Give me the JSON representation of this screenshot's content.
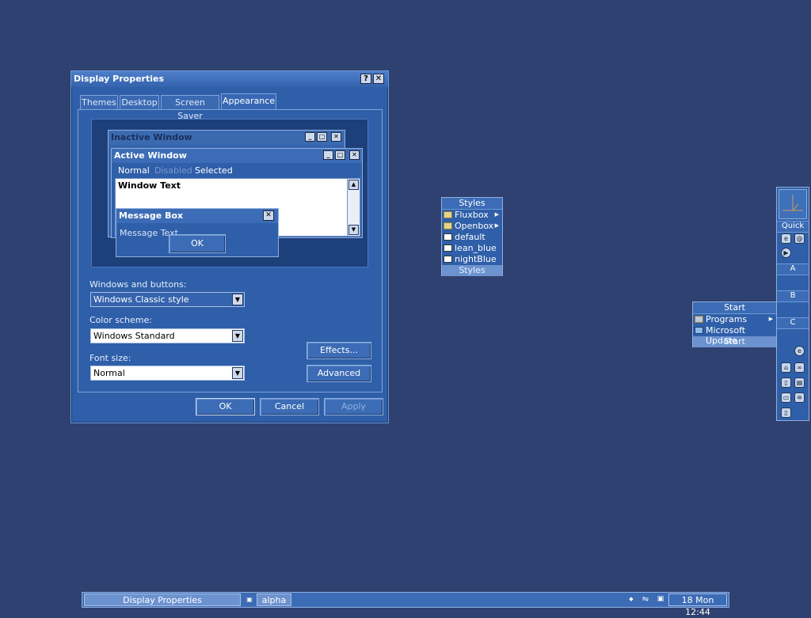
{
  "dialog": {
    "title": "Display Properties",
    "help_glyph": "?",
    "close_glyph": "✕",
    "tabs": [
      "Themes",
      "Desktop",
      "Screen Saver",
      "Appearance"
    ],
    "preview": {
      "inactive_title": "Inactive Window",
      "active_title": "Active Window",
      "menu_normal": "Normal",
      "menu_disabled": "Disabled",
      "menu_selected": "Selected",
      "window_text": "Window Text",
      "msgbox_title": "Message Box",
      "msgbox_text": "Message Text",
      "msgbox_ok": "OK"
    },
    "windows_buttons_label": "Windows and buttons:",
    "windows_buttons_value": "Windows Classic style",
    "color_scheme_label": "Color scheme:",
    "color_scheme_value": "Windows Standard",
    "font_size_label": "Font size:",
    "font_size_value": "Normal",
    "effects_label": "Effects...",
    "advanced_label": "Advanced",
    "ok_label": "OK",
    "cancel_label": "Cancel",
    "apply_label": "Apply"
  },
  "styles_menu": {
    "title": "Styles",
    "footer": "Styles",
    "items": [
      {
        "label": "Fluxbox",
        "icon": "folder-icon",
        "submenu": true
      },
      {
        "label": "Openbox",
        "icon": "folder-icon",
        "submenu": true
      },
      {
        "label": "default",
        "icon": "document-icon",
        "submenu": false
      },
      {
        "label": "lean_blue",
        "icon": "document-icon",
        "submenu": false
      },
      {
        "label": "nightBlue",
        "icon": "document-icon",
        "submenu": false
      }
    ]
  },
  "start_menu": {
    "title": "Start",
    "footer": "Start",
    "items": [
      {
        "label": "Programs",
        "icon": "programs-icon",
        "submenu": true
      },
      {
        "label": "Microsoft Update",
        "icon": "update-icon",
        "submenu": false
      }
    ]
  },
  "slit": {
    "quick_label": "Quick",
    "a_label": "A",
    "b_label": "B",
    "c_label": "C"
  },
  "taskbar": {
    "task_label": "Display Properties",
    "workspace_label": "alpha",
    "clock": "18 Mon 12:44"
  },
  "colors": {
    "desktop": "#2f4170",
    "window": "#2f5fa8",
    "accent": "#6c93cf"
  }
}
